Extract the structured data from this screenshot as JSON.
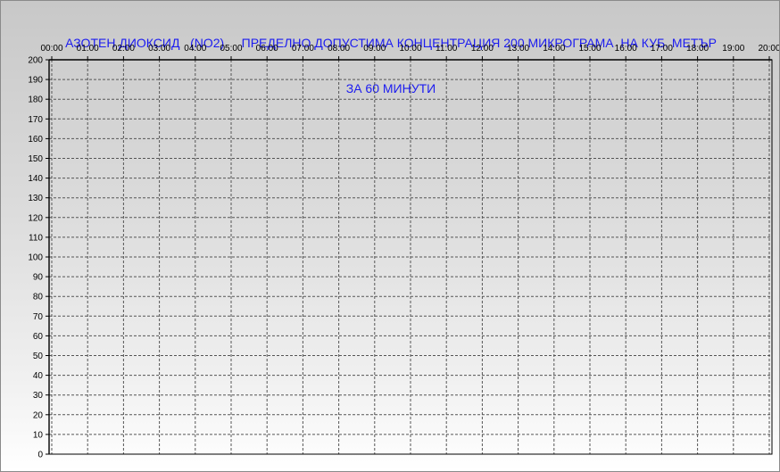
{
  "chart_data": {
    "type": "line",
    "title_line1": "АЗОТЕН ДИОКСИД   (NO2)     ПРЕДЕЛНО ДОПУСТИМА КОНЦЕНТРАЦИЯ 200 МИКРОГРАМА  НА КУБ. МЕТЪР",
    "title_line2": "ЗА 60 МИНУТИ",
    "xlabel": "",
    "ylabel": "",
    "x_ticks": [
      "00:00",
      "01:00",
      "02:00",
      "03:00",
      "04:00",
      "05:00",
      "06:00",
      "07:00",
      "08:00",
      "09:00",
      "10:00",
      "11:00",
      "12:00",
      "13:00",
      "14:00",
      "15:00",
      "16:00",
      "17:00",
      "18:00",
      "19:00",
      "20:00"
    ],
    "ylim": [
      0,
      200
    ],
    "y_step": 10,
    "grid": true,
    "grid_style": "dashed",
    "series": []
  },
  "colors": {
    "title": "#1c1cf0",
    "grid": "#555555",
    "axis": "#000000",
    "background_top": "#c8c8c8",
    "background_bottom": "#ffffff"
  }
}
